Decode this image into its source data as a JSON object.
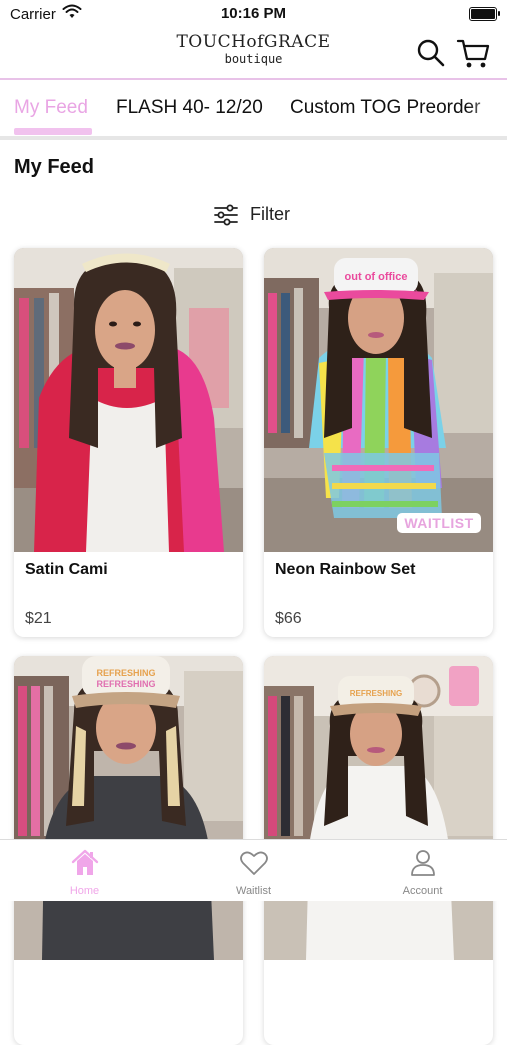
{
  "status_bar": {
    "carrier": "Carrier",
    "time": "10:16 PM"
  },
  "header": {
    "logo_main": "TOUCHofGRACE",
    "logo_sub": "boutique",
    "search_icon": "search-icon",
    "cart_icon": "cart-icon"
  },
  "tabs": [
    {
      "label": "My Feed",
      "active": true
    },
    {
      "label": "FLASH 40- 12/20",
      "active": false
    },
    {
      "label": "Custom TOG Preorder",
      "active": false
    }
  ],
  "feed": {
    "title": "My Feed",
    "filter_label": "Filter"
  },
  "products": [
    {
      "name": "Satin Cami",
      "price": "$21",
      "badge": ""
    },
    {
      "name": "Neon Rainbow Set",
      "price": "$66",
      "badge": "WAITLIST"
    },
    {
      "name": "",
      "price": "",
      "badge": ""
    },
    {
      "name": "",
      "price": "",
      "badge": ""
    }
  ],
  "bottom_nav": [
    {
      "label": "Home",
      "icon": "home-icon",
      "active": true
    },
    {
      "label": "Waitlist",
      "icon": "heart-icon",
      "active": false
    },
    {
      "label": "Account",
      "icon": "account-icon",
      "active": false
    }
  ],
  "colors": {
    "accent_pink": "#f0a6e9",
    "divider_pink": "#e8c2e8"
  }
}
